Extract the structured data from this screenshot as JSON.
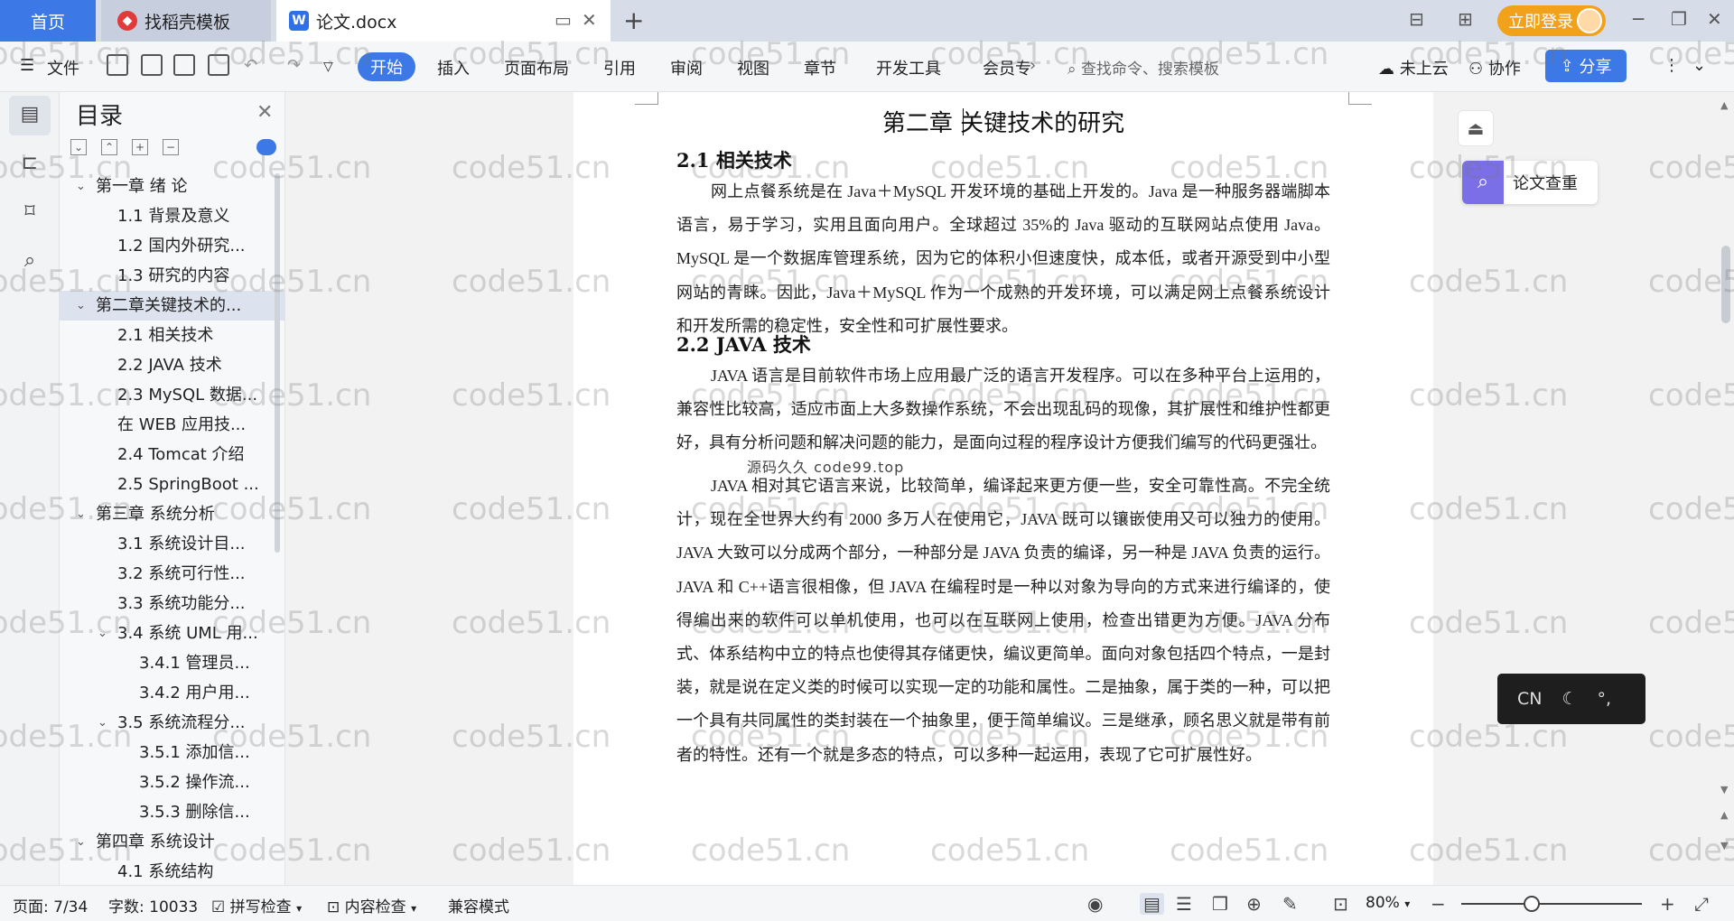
{
  "tabs": {
    "home": "首页",
    "template": "找稻壳模板",
    "document": "论文.docx"
  },
  "header": {
    "login": "立即登录"
  },
  "ribbon": {
    "file": "文件",
    "items": [
      "开始",
      "插入",
      "页面布局",
      "引用",
      "审阅",
      "视图",
      "章节",
      "开发工具",
      "会员专"
    ],
    "search_placeholder": "查找命令、搜索模板",
    "cloud": "未上云",
    "collab": "协作",
    "share": "分享"
  },
  "toc": {
    "title": "目录",
    "items": [
      {
        "label": "第一章  绪  论",
        "level": 1,
        "expanded": true
      },
      {
        "label": "1.1 背景及意义",
        "level": 2
      },
      {
        "label": "1.2 国内外研究...",
        "level": 2
      },
      {
        "label": "1.3 研究的内容",
        "level": 2
      },
      {
        "label": "第二章关键技术的...",
        "level": 1,
        "expanded": true,
        "active": true
      },
      {
        "label": "2.1 相关技术",
        "level": 2
      },
      {
        "label": "2.2 JAVA 技术",
        "level": 2
      },
      {
        "label": "2.3 MySQL 数据...",
        "level": 2
      },
      {
        "label": "在 WEB 应用技...",
        "level": 2
      },
      {
        "label": "2.4 Tomcat 介绍",
        "level": 2
      },
      {
        "label": "2.5 SpringBoot ...",
        "level": 2
      },
      {
        "label": "第三章  系统分析",
        "level": 1,
        "expanded": true
      },
      {
        "label": "3.1  系统设计目...",
        "level": 2
      },
      {
        "label": "3.2  系统可行性...",
        "level": 2
      },
      {
        "label": "3.3  系统功能分...",
        "level": 2
      },
      {
        "label": "3.4 系统 UML 用...",
        "level": 2,
        "expanded": true
      },
      {
        "label": "3.4.1 管理员...",
        "level": 3
      },
      {
        "label": "3.4.2 用户用...",
        "level": 3
      },
      {
        "label": "3.5 系统流程分...",
        "level": 2,
        "expanded": true
      },
      {
        "label": "3.5.1 添加信...",
        "level": 3
      },
      {
        "label": "3.5.2 操作流...",
        "level": 3
      },
      {
        "label": "3.5.3 删除信...",
        "level": 3
      },
      {
        "label": "第四章  系统设计",
        "level": 1,
        "expanded": true
      },
      {
        "label": "4.1  系统结构",
        "level": 2
      }
    ]
  },
  "document": {
    "chapter_title": "第二章  关键技术的研究",
    "section1_title": "2.1 相关技术",
    "section1_para": "网上点餐系统是在 Java＋MySQL 开发环境的基础上开发的。Java 是一种服务器端脚本语言，易于学习，实用且面向用户。全球超过 35%的 Java 驱动的互联网站点使用 Java。MySQL 是一个数据库管理系统，因为它的体积小但速度快，成本低，或者开源受到中小型网站的青睐。因此，Java＋MySQL 作为一个成熟的开发环境，可以满足网上点餐系统设计和开发所需的稳定性，安全性和可扩展性要求。",
    "section2_title": "2.2  JAVA 技术",
    "section2_para1": "JAVA 语言是目前软件市场上应用最广泛的语言开发程序。可以在多种平台上运用的，兼容性比较高，适应市面上大多数操作系统，不会出现乱码的现像，其扩展性和维护性都更好，具有分析问题和解决问题的能力，是面向过程的程序设计方便我们编写的代码更强壮。",
    "section2_para2": "JAVA 相对其它语言来说，比较简单，编译起来更方便一些，安全可靠性高。不完全统计，现在全世界大约有 2000 多万人在使用它，JAVA 既可以镶嵌使用又可以独力的使用。JAVA 大致可以分成两个部分，一种部分是 JAVA 负责的编译，另一种是 JAVA 负责的运行。JAVA 和 C++语言很相像，但 JAVA 在编程时是一种以对象为导向的方式来进行编译的，使得编出来的软件可以单机使用，也可以在互联网上使用，检查出错更为方便。JAVA 分布式、体系结构中立的特点也使得其存储更快，编议更简单。面向对象包括四个特点，一是封装，就是说在定义类的时候可以实现一定的功能和属性。二是抽象，属于类的一种，可以把一个具有共同属性的类封装在一个抽象里，便于简单编议。三是继承，顾名思义就是带有前者的特性。还有一个就是多态的特点，可以多种一起运用，表现了它可扩展性好。",
    "overlay_text": "源码久久  code99.top"
  },
  "side": {
    "plagiarism": "论文查重",
    "ime": "CN"
  },
  "status": {
    "page": "页面: 7/34",
    "words": "字数: 10033",
    "spell": "拼写检查",
    "content": "内容检查",
    "compat": "兼容模式",
    "zoom": "80%",
    "zoom_level": 0.8
  },
  "watermark": "code51.cn"
}
